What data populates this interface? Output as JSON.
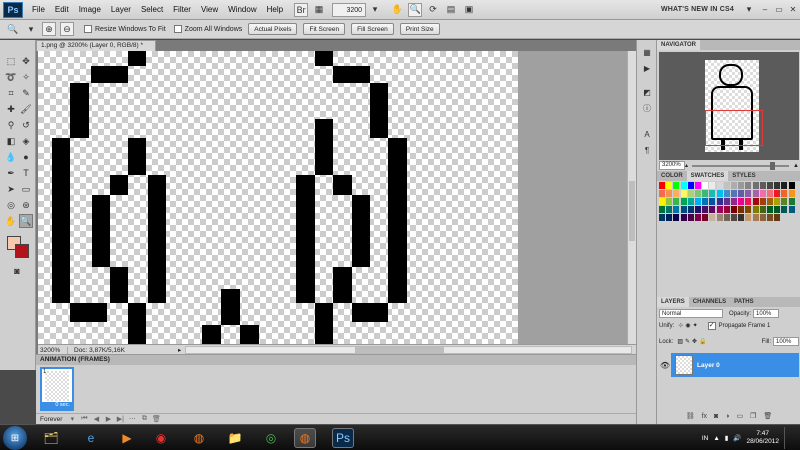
{
  "menubar": {
    "logo": "Ps",
    "items": [
      "File",
      "Edit",
      "Image",
      "Layer",
      "Select",
      "Filter",
      "View",
      "Window",
      "Help"
    ],
    "zoom": "3200",
    "workspace": "WHAT'S NEW IN CS4"
  },
  "options": {
    "resize_windows": "Resize Windows To Fit",
    "zoom_all": "Zoom All Windows",
    "actual_pixels": "Actual Pixels",
    "fit_screen": "Fit Screen",
    "fill_screen": "Fill Screen",
    "print_size": "Print Size"
  },
  "document": {
    "tab": "1.png @ 3200% (Layer 0, RGB/8) *",
    "status_zoom": "3200%",
    "status_doc": "Doc: 3,87K/5,16K"
  },
  "animation": {
    "title": "ANIMATION (FRAMES)",
    "frame_number": "1",
    "frame_delay": "0 sec.",
    "loop": "Forever"
  },
  "navigator": {
    "tab": "NAVIGATOR",
    "zoom": "3200%"
  },
  "swatch_panel": {
    "tabs": [
      "COLOR",
      "SWATCHES",
      "STYLES"
    ],
    "colors": [
      "#ff0000",
      "#ffff00",
      "#00ff00",
      "#00ffff",
      "#0000ff",
      "#ff00ff",
      "#ffffff",
      "#ebebeb",
      "#d6d6d6",
      "#c2c2c2",
      "#adadad",
      "#999999",
      "#858585",
      "#707070",
      "#5c5c5c",
      "#474747",
      "#333333",
      "#1f1f1f",
      "#000000",
      "#f26c4f",
      "#f68e56",
      "#fbaf5d",
      "#fff568",
      "#acd372",
      "#7cc576",
      "#3bb878",
      "#1abbb4",
      "#00bff3",
      "#438ccb",
      "#5574b9",
      "#605ca8",
      "#855fa8",
      "#a763a8",
      "#f06eaa",
      "#f26d7d",
      "#ed1c24",
      "#f26522",
      "#f7941d",
      "#fff200",
      "#8dc73f",
      "#39b54a",
      "#00a651",
      "#00a99d",
      "#00aeef",
      "#0072bc",
      "#0054a6",
      "#2e3192",
      "#662d91",
      "#92278f",
      "#ec008c",
      "#ed145b",
      "#9e0b0f",
      "#a0410d",
      "#a36209",
      "#aba000",
      "#598527",
      "#1a7b30",
      "#007236",
      "#00746b",
      "#0076a3",
      "#004b80",
      "#003471",
      "#1b1464",
      "#440e62",
      "#630460",
      "#9e005d",
      "#9e0039",
      "#790000",
      "#7b2e00",
      "#7d4900",
      "#827b00",
      "#406618",
      "#005e20",
      "#005826",
      "#005952",
      "#005b7f",
      "#003663",
      "#002157",
      "#0d004c",
      "#32004b",
      "#4b0049",
      "#7b0046",
      "#7a0026",
      "#c7b299",
      "#998675",
      "#736357",
      "#534741",
      "#37302d",
      "#c69c6d",
      "#a67c52",
      "#8c6239",
      "#754c24",
      "#603913"
    ]
  },
  "layers": {
    "tabs": [
      "LAYERS",
      "CHANNELS",
      "PATHS"
    ],
    "blend_mode": "Normal",
    "opacity_label": "Opacity:",
    "opacity": "100%",
    "unify_label": "Unify:",
    "propagate": "Propagate Frame 1",
    "lock_label": "Lock:",
    "fill_label": "Fill:",
    "fill": "100%",
    "layer_name": "Layer 0"
  },
  "taskbar": {
    "language": "IN",
    "time": "7:47",
    "date": "28/06/2012"
  }
}
